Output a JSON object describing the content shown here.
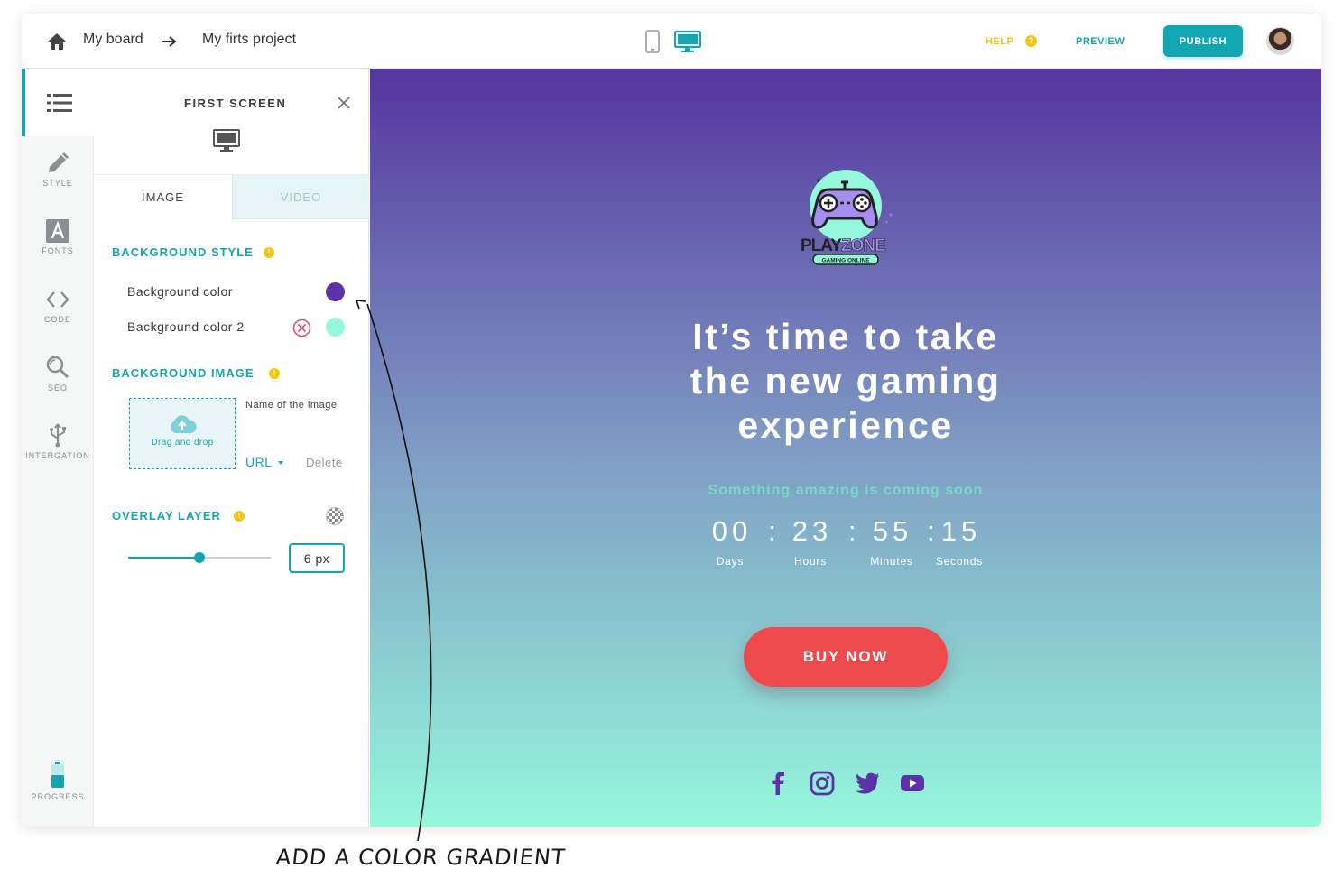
{
  "topbar": {
    "breadcrumb": [
      "My board",
      "My firts project"
    ],
    "help_label": "HELP",
    "help_icon": "question-icon",
    "preview_label": "PREVIEW",
    "publish_label": "PUBLISH",
    "active_device": "desktop"
  },
  "rail": {
    "items": [
      {
        "label": "STYLE",
        "icon": "pencil-icon"
      },
      {
        "label": "FONTS",
        "icon": "font-icon"
      },
      {
        "label": "CODE",
        "icon": "code-icon"
      },
      {
        "label": "SEO",
        "icon": "seo-icon"
      },
      {
        "label": "INTERGATION",
        "icon": "usb-icon"
      },
      {
        "label": "PROGRESS",
        "icon": "battery-icon"
      }
    ]
  },
  "panel": {
    "title": "FIRST SCREEN",
    "tabs": [
      "IMAGE",
      "VIDEO"
    ],
    "active_tab": "IMAGE",
    "background_style": {
      "title": "BACKGROUND STYLE",
      "color1_label": "Background color",
      "color1": "#5b33a6",
      "color2_label": "Background color 2",
      "color2": "#95f7dc"
    },
    "background_image": {
      "title": "BACKGROUND IMAGE",
      "dropzone_label": "Drag and drop",
      "name_label": "Name of the image",
      "url_label": "URL",
      "delete_label": "Delete"
    },
    "overlay": {
      "title": "OVERLAY LAYER",
      "value_label": "6 px",
      "slider_fraction": 0.5
    }
  },
  "canvas": {
    "logo": {
      "brand_main": "PLAY",
      "brand_accent": "ZONE",
      "tagline": "GAMING ONLINE"
    },
    "headline": [
      "It’s time to take",
      "the new gaming",
      "experience"
    ],
    "subhead": "Something amazing is coming soon",
    "countdown": [
      {
        "value": "00",
        "label": "Days"
      },
      {
        "value": "23",
        "label": "Hours"
      },
      {
        "value": "55",
        "label": "Minutes"
      },
      {
        "value": "15",
        "label": "Seconds"
      }
    ],
    "countdown_separator": ":",
    "cta_label": "BUY NOW",
    "social": [
      "facebook-icon",
      "instagram-icon",
      "twitter-icon",
      "youtube-icon"
    ],
    "gradient": {
      "top": "#5535a0",
      "bottom": "#95f7dc"
    }
  },
  "annotation": "ADD A COLOR GRADIENT",
  "colors": {
    "accent": "#12a6b3",
    "warning": "#f3c614",
    "cta": "#ee4a4d",
    "social": "#5b33a6"
  }
}
